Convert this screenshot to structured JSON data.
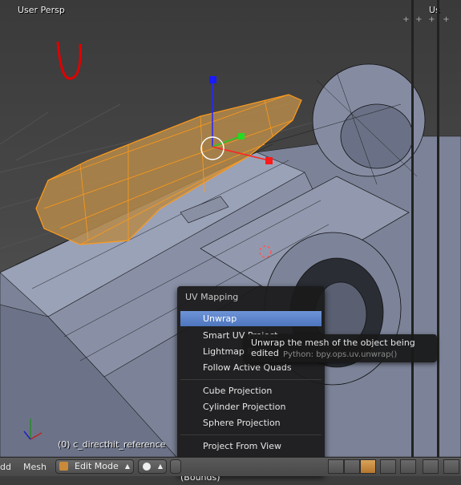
{
  "viewport": {
    "view_label": "User Persp",
    "right_view_label": "Us",
    "object_label": "(0) c_directhit_reference"
  },
  "menu": {
    "title": "UV Mapping",
    "items": [
      {
        "label": "Unwrap"
      },
      {
        "label": "Smart UV Project"
      },
      {
        "label": "Lightmap Pack"
      },
      {
        "label": "Follow Active Quads"
      },
      {
        "label": "Cube Projection"
      },
      {
        "label": "Cylinder Projection"
      },
      {
        "label": "Sphere Projection"
      },
      {
        "label": "Project From View"
      },
      {
        "label": "Project from View (Bounds)"
      }
    ],
    "active_index": 0
  },
  "tooltip": {
    "description": "Unwrap the mesh of the object being edited",
    "python": "Python: bpy.ops.uv.unwrap()"
  },
  "header": {
    "add_menu": "dd",
    "mesh_menu": "Mesh",
    "mode": "Edit Mode"
  },
  "colors": {
    "menu_active": "#5680c8",
    "selection": "#ff8c00",
    "grease_pencil": "#e00000"
  }
}
